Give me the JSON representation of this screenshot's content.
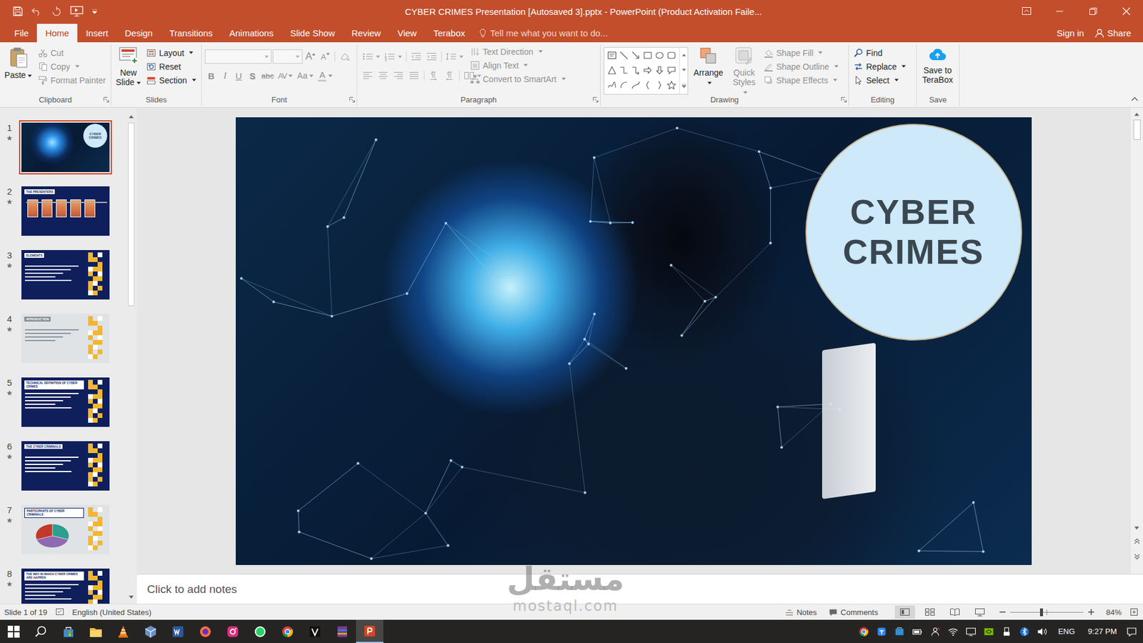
{
  "window": {
    "title": "CYBER CRIMES Presentation [Autosaved 3].pptx - PowerPoint (Product Activation Faile..."
  },
  "menu": {
    "tabs": [
      {
        "label": "File",
        "selected": false
      },
      {
        "label": "Home",
        "selected": true
      },
      {
        "label": "Insert",
        "selected": false
      },
      {
        "label": "Design",
        "selected": false
      },
      {
        "label": "Transitions",
        "selected": false
      },
      {
        "label": "Animations",
        "selected": false
      },
      {
        "label": "Slide Show",
        "selected": false
      },
      {
        "label": "Review",
        "selected": false
      },
      {
        "label": "View",
        "selected": false
      },
      {
        "label": "Terabox",
        "selected": false
      }
    ],
    "tell_me": "Tell me what you want to do...",
    "sign_in": "Sign in",
    "share": "Share"
  },
  "ribbon": {
    "groups": [
      {
        "label": "Clipboard",
        "kind": "clipboard",
        "items": [
          {
            "label": "Paste",
            "kind": "paste",
            "disabled": false,
            "dropdown": true
          },
          {
            "label": "Cut",
            "kind": "cut",
            "disabled": true,
            "dropdown": false
          },
          {
            "label": "Copy",
            "kind": "copy",
            "disabled": true,
            "dropdown": true
          },
          {
            "label": "Format Painter",
            "kind": "format-painter",
            "disabled": true,
            "dropdown": false
          }
        ]
      },
      {
        "label": "Slides",
        "kind": "slides",
        "items": [
          {
            "label": "New Slide",
            "kind": "new-slide",
            "disabled": false,
            "dropdown": true
          },
          {
            "label": "Layout",
            "kind": "layout",
            "disabled": false,
            "dropdown": true
          },
          {
            "label": "Reset",
            "kind": "reset",
            "disabled": false,
            "dropdown": false
          },
          {
            "label": "Section",
            "kind": "section",
            "disabled": false,
            "dropdown": true
          }
        ]
      },
      {
        "label": "Font",
        "kind": "font",
        "fields": [
          {
            "disabled": true
          },
          {
            "disabled": true
          }
        ],
        "items": [
          {
            "glyph": "A",
            "kind": "grow",
            "disabled": true,
            "dropdown": false
          },
          {
            "glyph": "A",
            "kind": "shrink",
            "disabled": true,
            "dropdown": false
          },
          {
            "kind": "clear",
            "disabled": true,
            "dropdown": false
          },
          {
            "glyph": "B",
            "kind": "bold",
            "disabled": true,
            "dropdown": false
          },
          {
            "glyph": "I",
            "kind": "italic",
            "disabled": true,
            "dropdown": false
          },
          {
            "glyph": "U",
            "kind": "underline",
            "disabled": true,
            "dropdown": false
          },
          {
            "glyph": "S",
            "kind": "shadow",
            "disabled": true,
            "dropdown": false
          },
          {
            "glyph": "abc",
            "kind": "strike",
            "disabled": true,
            "dropdown": false
          },
          {
            "glyph": "AV",
            "kind": "spacing",
            "disabled": true,
            "dropdown": true
          },
          {
            "glyph": "Aa",
            "kind": "case",
            "disabled": true,
            "dropdown": true
          },
          {
            "glyph": "A",
            "kind": "color",
            "disabled": true,
            "dropdown": true
          }
        ]
      },
      {
        "label": "Paragraph",
        "kind": "paragraph",
        "rows": [
          [
            {
              "kind": "bullets",
              "disabled": true,
              "dropdown": true
            },
            {
              "kind": "numbering",
              "disabled": true,
              "dropdown": true
            },
            {
              "kind": "indent-less",
              "disabled": true,
              "dropdown": false
            },
            {
              "kind": "indent-more",
              "disabled": true,
              "dropdown": false
            },
            {
              "kind": "line-spacing",
              "disabled": true,
              "dropdown": true
            }
          ],
          [
            {
              "kind": "align-left",
              "disabled": true,
              "dropdown": false
            },
            {
              "kind": "align-center",
              "disabled": true,
              "dropdown": false
            },
            {
              "kind": "align-right",
              "disabled": true,
              "dropdown": false
            },
            {
              "kind": "justify",
              "disabled": true,
              "dropdown": false
            },
            {
              "kind": "ltr",
              "disabled": true,
              "dropdown": false
            },
            {
              "kind": "rtl",
              "disabled": true,
              "dropdown": false
            },
            {
              "kind": "columns",
              "disabled": true,
              "dropdown": true
            }
          ]
        ],
        "items": [
          {
            "label": "Text Direction",
            "kind": "text-direction",
            "disabled": true,
            "dropdown": true
          },
          {
            "label": "Align Text",
            "kind": "align-text",
            "disabled": true,
            "dropdown": true
          },
          {
            "label": "Convert to SmartArt",
            "kind": "smartart",
            "disabled": true,
            "dropdown": true
          }
        ]
      },
      {
        "label": "Drawing",
        "kind": "drawing",
        "items": [
          {
            "label": "Arrange",
            "kind": "arrange",
            "disabled": false,
            "dropdown": true
          },
          {
            "label": "Quick Styles",
            "kind": "quick-styles",
            "disabled": true,
            "dropdown": true
          },
          {
            "label": "Shape Fill",
            "kind": "shape-fill",
            "disabled": true,
            "dropdown": true
          },
          {
            "label": "Shape Outline",
            "kind": "shape-outline",
            "disabled": true,
            "dropdown": true
          },
          {
            "label": "Shape Effects",
            "kind": "shape-effects",
            "disabled": true,
            "dropdown": true
          }
        ]
      },
      {
        "label": "Editing",
        "kind": "editing",
        "items": [
          {
            "label": "Find",
            "kind": "find",
            "disabled": false,
            "dropdown": false
          },
          {
            "label": "Replace",
            "kind": "replace",
            "disabled": false,
            "dropdown": true
          },
          {
            "label": "Select",
            "kind": "select",
            "disabled": false,
            "dropdown": true
          }
        ]
      },
      {
        "label": "Save",
        "kind": "save",
        "items": [
          {
            "label": "Save to TeraBox",
            "kind": "save-cloud",
            "disabled": false,
            "dropdown": false
          }
        ]
      }
    ]
  },
  "slides_pane": {
    "slides": [
      {
        "number": "1",
        "selected": true,
        "kind": "title",
        "title": "CYBER CRIMES"
      },
      {
        "number": "2",
        "selected": false,
        "kind": "presenters",
        "title": "THE PRESENTERS"
      },
      {
        "number": "3",
        "selected": false,
        "kind": "dark",
        "title": "ELEMENTS"
      },
      {
        "number": "4",
        "selected": false,
        "kind": "light",
        "title": "INTRODUCTION"
      },
      {
        "number": "5",
        "selected": false,
        "kind": "dark",
        "title": "TECHNICAL DEFINITION OF CYBER CRIMES"
      },
      {
        "number": "6",
        "selected": false,
        "kind": "dark",
        "title": "THE CYBER CRIMINALS"
      },
      {
        "number": "7",
        "selected": false,
        "kind": "chart",
        "title": "PARTICIPANTS OF CYBER CRIMINALS",
        "pie": [
          30,
          40,
          30
        ]
      },
      {
        "number": "8",
        "selected": false,
        "kind": "dark",
        "title": "THE WAY IN WHICH CYBER CRIMES ARE HAPPEN"
      }
    ]
  },
  "slide": {
    "title": "CYBER CRIMES"
  },
  "notes": {
    "placeholder": "Click to add notes"
  },
  "status_bar": {
    "slide": "Slide 1 of 19",
    "language": "English (United States)",
    "notes": "Notes",
    "comments": "Comments",
    "views": [
      {
        "kind": "normal",
        "selected": true
      },
      {
        "kind": "sorter",
        "selected": false
      },
      {
        "kind": "reading",
        "selected": false
      },
      {
        "kind": "slideshow",
        "selected": false
      }
    ],
    "zoom": {
      "level": 0.42,
      "reading": "84%"
    }
  },
  "taskbar": {
    "apps": [
      {
        "kind": "start",
        "active": false
      },
      {
        "kind": "search",
        "active": false
      },
      {
        "kind": "store",
        "active": false
      },
      {
        "kind": "explorer",
        "active": false
      },
      {
        "kind": "vlc",
        "active": false
      },
      {
        "kind": "box",
        "active": false
      },
      {
        "kind": "word",
        "active": false
      },
      {
        "kind": "firefox",
        "active": false
      },
      {
        "kind": "instagram",
        "active": false
      },
      {
        "kind": "whatsapp",
        "active": false
      },
      {
        "kind": "chrome",
        "active": false
      },
      {
        "kind": "vegas",
        "active": false
      },
      {
        "kind": "winrar",
        "active": false
      },
      {
        "kind": "powerpoint",
        "active": true
      }
    ],
    "tray": [
      {
        "kind": "chrome"
      },
      {
        "kind": "terabox"
      },
      {
        "kind": "store"
      },
      {
        "kind": "battery"
      },
      {
        "kind": "people"
      },
      {
        "kind": "wifi"
      },
      {
        "kind": "monitor"
      },
      {
        "kind": "nvidia"
      },
      {
        "kind": "usb"
      },
      {
        "kind": "bluetooth"
      },
      {
        "kind": "volume"
      }
    ],
    "language": "ENG",
    "time": "9:27 PM"
  },
  "watermark": {
    "arabic": "مستقل",
    "latin": "mostaql.com"
  }
}
